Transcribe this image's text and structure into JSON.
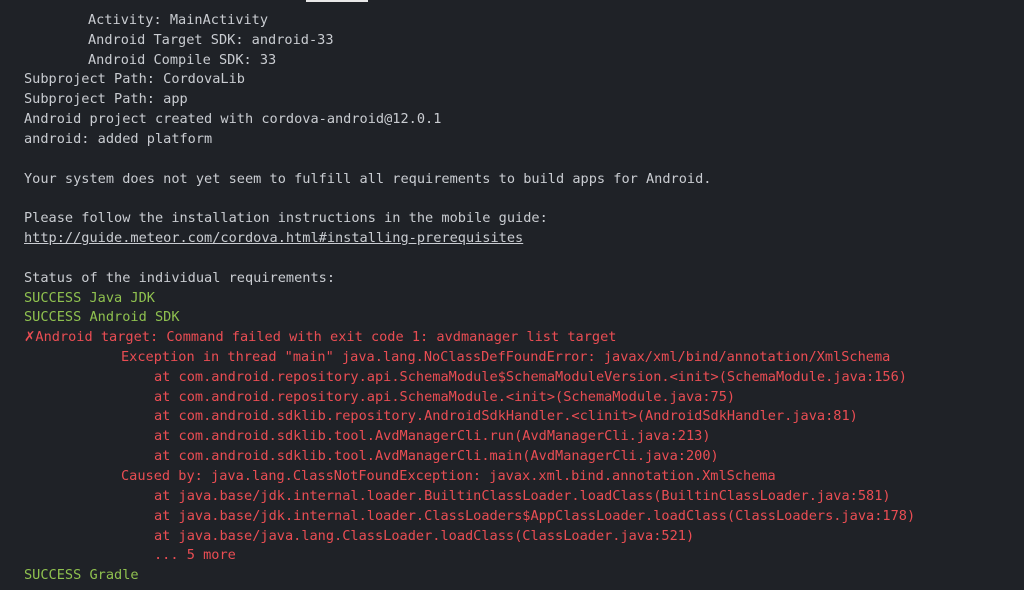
{
  "terminal": {
    "lines": [
      {
        "text": "Activity: MainActivity",
        "style": "default"
      },
      {
        "text": "Android Target SDK: android-33",
        "style": "default"
      },
      {
        "text": "Android Compile SDK: 33",
        "style": "default"
      },
      {
        "text": "Subproject Path: CordovaLib",
        "style": "default"
      },
      {
        "text": "Subproject Path: app",
        "style": "default"
      },
      {
        "text": "Android project created with cordova-android@12.0.1",
        "style": "default"
      },
      {
        "text": "android: added platform",
        "style": "default"
      },
      {
        "text": "Your system does not yet seem to fulfill all requirements to build apps for Android.",
        "style": "default"
      },
      {
        "text": "Please follow the installation instructions in the mobile guide:",
        "style": "default"
      },
      {
        "text": "http://guide.meteor.com/cordova.html#installing-prerequisites",
        "style": "link"
      },
      {
        "text": "Status of the individual requirements:",
        "style": "default"
      },
      {
        "text": "SUCCESS Java JDK",
        "style": "green"
      },
      {
        "text": "SUCCESS Android SDK",
        "style": "green"
      },
      {
        "text": "Android target: Command failed with exit code 1: avdmanager list target",
        "style": "red",
        "icon": "✗"
      },
      {
        "text": "Exception in thread \"main\" java.lang.NoClassDefFoundError: javax/xml/bind/annotation/XmlSchema",
        "style": "red"
      },
      {
        "text": "at com.android.repository.api.SchemaModule$SchemaModuleVersion.<init>(SchemaModule.java:156)",
        "style": "red"
      },
      {
        "text": "at com.android.repository.api.SchemaModule.<init>(SchemaModule.java:75)",
        "style": "red"
      },
      {
        "text": "at com.android.sdklib.repository.AndroidSdkHandler.<clinit>(AndroidSdkHandler.java:81)",
        "style": "red"
      },
      {
        "text": "at com.android.sdklib.tool.AvdManagerCli.run(AvdManagerCli.java:213)",
        "style": "red"
      },
      {
        "text": "at com.android.sdklib.tool.AvdManagerCli.main(AvdManagerCli.java:200)",
        "style": "red"
      },
      {
        "text": "Caused by: java.lang.ClassNotFoundException: javax.xml.bind.annotation.XmlSchema",
        "style": "red"
      },
      {
        "text": "at java.base/jdk.internal.loader.BuiltinClassLoader.loadClass(BuiltinClassLoader.java:581)",
        "style": "red"
      },
      {
        "text": "at java.base/jdk.internal.loader.ClassLoaders$AppClassLoader.loadClass(ClassLoaders.java:178)",
        "style": "red"
      },
      {
        "text": "at java.base/java.lang.ClassLoader.loadClass(ClassLoader.java:521)",
        "style": "red"
      },
      {
        "text": "... 5 more",
        "style": "red"
      },
      {
        "text": "SUCCESS Gradle",
        "style": "green"
      }
    ]
  },
  "colors": {
    "background": "#1f2227",
    "text": "#c9ccd1",
    "success": "#8fc14f",
    "error": "#ea4d53"
  }
}
